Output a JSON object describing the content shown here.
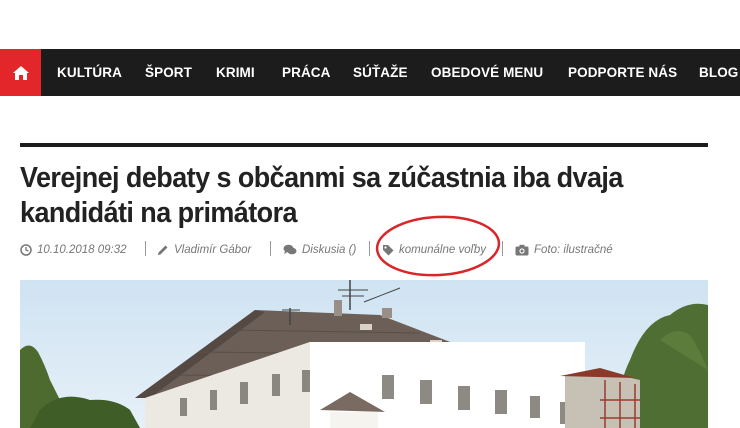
{
  "nav": {
    "home_icon": "home-icon",
    "items": [
      "KULTÚRA",
      "ŠPORT",
      "KRIMI",
      "PRÁCA",
      "SÚŤAŽE",
      "OBEDOVÉ MENU",
      "PODPORTE NÁS",
      "BLOG"
    ]
  },
  "article": {
    "title": "Verejnej debaty s občanmi sa zúčastnia iba dvaja kandidáti na primátora",
    "date": "10.10.2018 09:32",
    "author": "Vladimír Gábor",
    "discussion": "Diskusia ()",
    "tag": "komunálne voľby",
    "photo_credit": "Foto: ilustračné"
  },
  "colors": {
    "accent": "#e3262a",
    "nav_bg": "#1c1c1c",
    "annotation": "#d8262b"
  }
}
